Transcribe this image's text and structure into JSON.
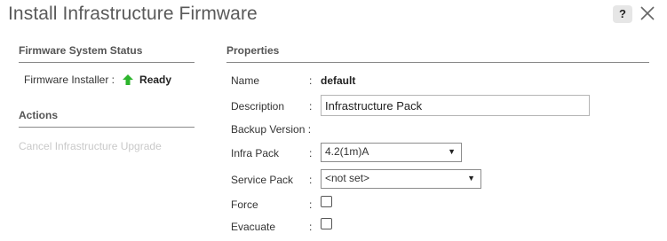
{
  "dialog": {
    "title": "Install Infrastructure Firmware",
    "help_label": "?",
    "close_icon": "close-icon"
  },
  "left": {
    "status_header": "Firmware System Status",
    "installer_label": "Firmware Installer :",
    "installer_status": "Ready",
    "ready_icon": "arrow-up-icon",
    "ready_icon_color": "#2db52d",
    "actions_header": "Actions",
    "actions": [
      {
        "label": "Cancel Infrastructure Upgrade",
        "enabled": false
      }
    ]
  },
  "properties": {
    "header": "Properties",
    "name_label": "Name",
    "name_value": "default",
    "description_label": "Description",
    "description_value": "Infrastructure Pack",
    "backup_version_label": "Backup Version :",
    "infra_pack_label": "Infra Pack",
    "infra_pack_value": "4.2(1m)A",
    "service_pack_label": "Service Pack",
    "service_pack_value": "<not set>",
    "force_label": "Force",
    "force_checked": false,
    "evacuate_label": "Evacuate",
    "evacuate_checked": false
  }
}
